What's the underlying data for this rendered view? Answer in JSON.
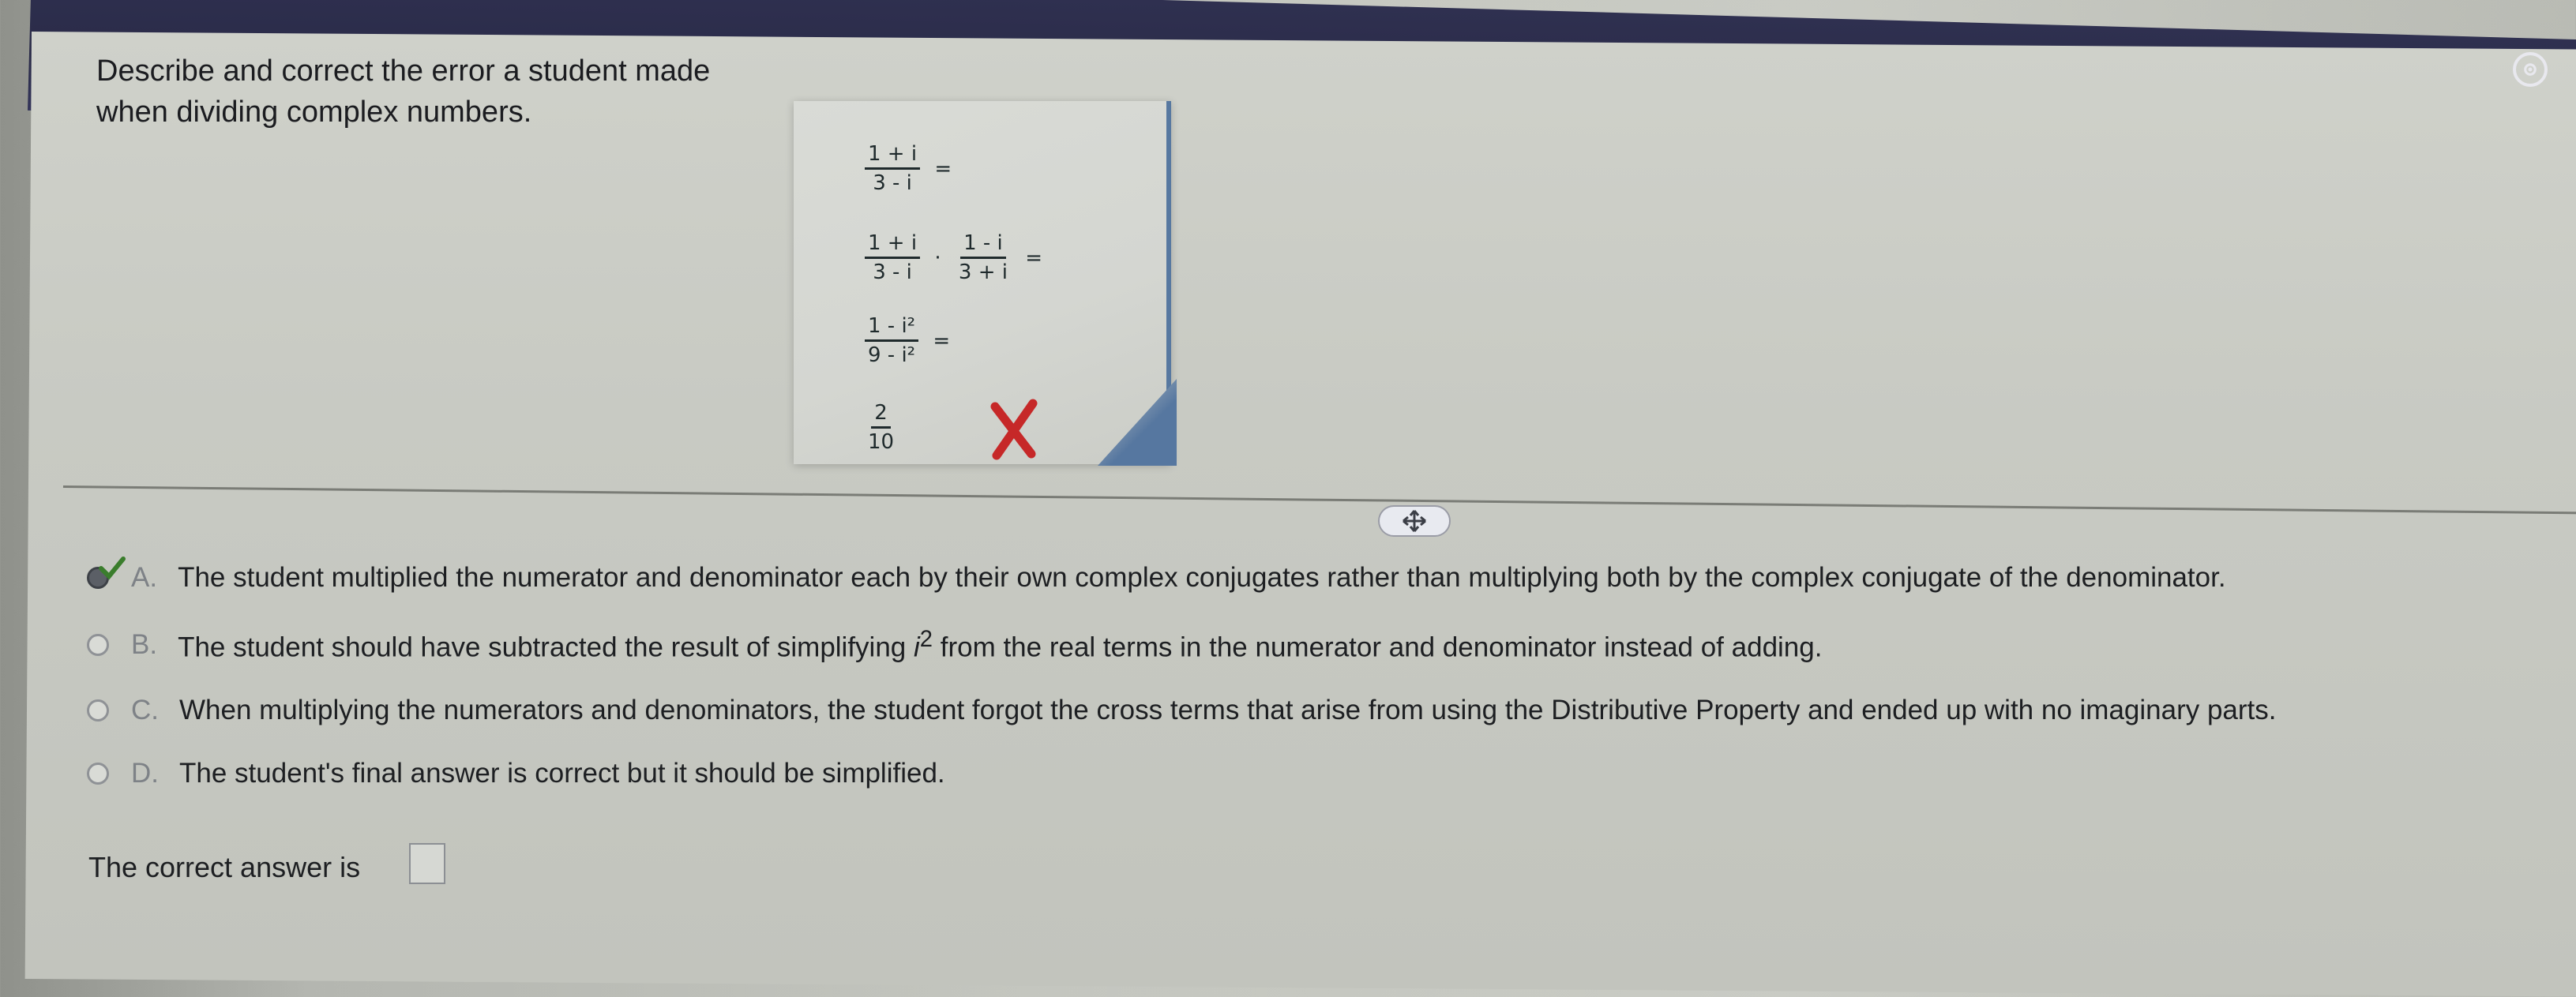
{
  "question": {
    "line1": "Describe and correct the error a student made",
    "line2": "when dividing complex numbers."
  },
  "work": {
    "step1": {
      "num": "1 + i",
      "den": "3 - i",
      "op": "="
    },
    "step2": {
      "num1": "1 + i",
      "den1": "3 - i",
      "dot": "·",
      "num2": "1 - i",
      "den2": "3 + i",
      "op": "="
    },
    "step3": {
      "num": "1 - i²",
      "den": "9 - i²",
      "op": "="
    },
    "step4": {
      "num": "2",
      "den": "10"
    },
    "error_mark": "x-mark-icon"
  },
  "options": [
    {
      "letter": "A.",
      "text": "The student multiplied the numerator and denominator each by their own complex conjugates rather than multiplying both by the complex conjugate of the denominator.",
      "selected": true
    },
    {
      "letter": "B.",
      "text_before": "The student should have subtracted the result of simplifying ",
      "math": "i",
      "sup": "2",
      "text_after": " from the real terms in the numerator and denominator instead of adding.",
      "selected": false
    },
    {
      "letter": "C.",
      "text": "When multiplying the numerators and denominators, the student forgot the cross terms that arise from using the Distributive Property and ended up with no imaginary parts.",
      "selected": false
    },
    {
      "letter": "D.",
      "text": "The student's final answer is correct but it should be simplified.",
      "selected": false
    }
  ],
  "answer": {
    "label": "The correct answer is",
    "value": ""
  },
  "colors": {
    "header": "#2a2b48",
    "error_red": "#c62828",
    "check_green": "#3a7d2c"
  }
}
